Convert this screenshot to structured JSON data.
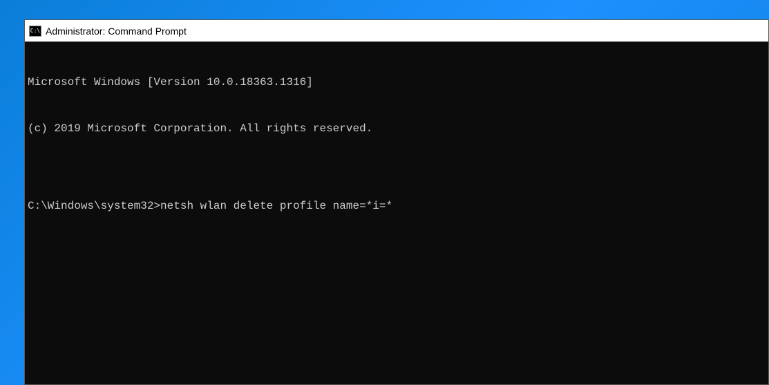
{
  "window": {
    "title": "Administrator: Command Prompt",
    "icon_name": "cmd-icon"
  },
  "terminal": {
    "header_line1": "Microsoft Windows [Version 10.0.18363.1316]",
    "header_line2": "(c) 2019 Microsoft Corporation. All rights reserved.",
    "blank": "",
    "prompt": "C:\\Windows\\system32>",
    "command": "netsh wlan delete profile name=*i=*"
  }
}
